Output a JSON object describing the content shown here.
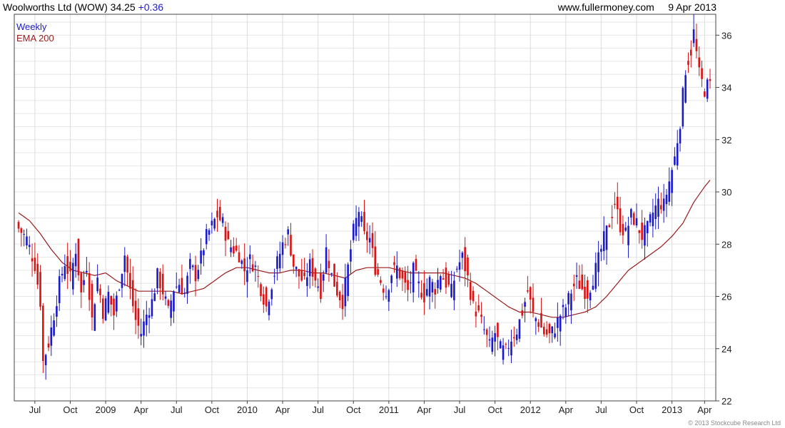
{
  "header": {
    "title": "Woolworths Ltd (WOW)",
    "price": "34.25",
    "change": "+0.36",
    "source": "www.fullermoney.com",
    "date": "9 Apr 2013"
  },
  "footer": {
    "copyright": "© 2013 Stockcube Research Ltd"
  },
  "chart_data": {
    "type": "line",
    "title": "Woolworths Ltd (WOW)",
    "legend": [
      {
        "name": "Weekly",
        "color": "#1a1acc"
      },
      {
        "name": "EMA 200",
        "color": "#9a1a1a"
      }
    ],
    "legend_placement": "top-left",
    "up_color": "#1a1acc",
    "down_color": "#dd1111",
    "ema_color": "#9a1a1a",
    "grid": true,
    "y_axis": {
      "position": "right",
      "min": 22,
      "max": 36.8,
      "ticks": [
        22,
        24,
        26,
        28,
        30,
        32,
        34,
        36
      ]
    },
    "x_axis": {
      "labels": [
        "Jul",
        "Oct",
        "2009",
        "Apr",
        "Jul",
        "Oct",
        "2010",
        "Apr",
        "Jul",
        "Oct",
        "2011",
        "Apr",
        "Jul",
        "Oct",
        "2012",
        "Apr",
        "Jul",
        "Oct",
        "2013",
        "Apr"
      ],
      "label_weeks": [
        6,
        19,
        32,
        45,
        58,
        71,
        84,
        97,
        110,
        123,
        136,
        149,
        162,
        175,
        188,
        201,
        214,
        227,
        240,
        252
      ]
    },
    "weeks": 255,
    "series": [
      {
        "name": "Weekly",
        "anchors": [
          [
            0,
            28.6
          ],
          [
            3,
            28.2
          ],
          [
            6,
            27.2
          ],
          [
            8,
            25.8
          ],
          [
            9,
            23.5
          ],
          [
            11,
            24.2
          ],
          [
            13,
            25.3
          ],
          [
            15,
            26.5
          ],
          [
            17,
            27.3
          ],
          [
            19,
            26.7
          ],
          [
            21,
            27.8
          ],
          [
            23,
            26.1
          ],
          [
            25,
            27.2
          ],
          [
            27,
            25.1
          ],
          [
            29,
            26.7
          ],
          [
            31,
            25.4
          ],
          [
            33,
            26.1
          ],
          [
            35,
            25.3
          ],
          [
            37,
            26.5
          ],
          [
            39,
            27.6
          ],
          [
            41,
            26.2
          ],
          [
            43,
            25.1
          ],
          [
            45,
            24.6
          ],
          [
            47,
            25.3
          ],
          [
            49,
            25.8
          ],
          [
            51,
            26.8
          ],
          [
            53,
            26.2
          ],
          [
            55,
            25.4
          ],
          [
            57,
            26.3
          ],
          [
            59,
            26.5
          ],
          [
            61,
            26.1
          ],
          [
            63,
            27.2
          ],
          [
            65,
            26.8
          ],
          [
            67,
            27.5
          ],
          [
            69,
            28.3
          ],
          [
            71,
            28.7
          ],
          [
            73,
            29.1
          ],
          [
            75,
            28.8
          ],
          [
            77,
            28.0
          ],
          [
            79,
            27.8
          ],
          [
            81,
            27.6
          ],
          [
            83,
            27.0
          ],
          [
            85,
            27.4
          ],
          [
            87,
            27.1
          ],
          [
            89,
            26.3
          ],
          [
            91,
            25.6
          ],
          [
            93,
            26.5
          ],
          [
            95,
            27.3
          ],
          [
            97,
            28.0
          ],
          [
            99,
            28.4
          ],
          [
            101,
            27.2
          ],
          [
            103,
            26.8
          ],
          [
            105,
            26.5
          ],
          [
            107,
            27.2
          ],
          [
            109,
            26.7
          ],
          [
            111,
            26.2
          ],
          [
            113,
            27.8
          ],
          [
            115,
            26.8
          ],
          [
            117,
            26.2
          ],
          [
            119,
            25.8
          ],
          [
            121,
            27.1
          ],
          [
            123,
            28.5
          ],
          [
            125,
            29.3
          ],
          [
            127,
            28.3
          ],
          [
            129,
            28.2
          ],
          [
            131,
            27.1
          ],
          [
            133,
            26.6
          ],
          [
            135,
            26.1
          ],
          [
            137,
            26.9
          ],
          [
            139,
            27.1
          ],
          [
            141,
            26.6
          ],
          [
            143,
            26.2
          ],
          [
            145,
            27.0
          ],
          [
            147,
            26.4
          ],
          [
            149,
            26.0
          ],
          [
            151,
            26.6
          ],
          [
            153,
            26.3
          ],
          [
            155,
            26.9
          ],
          [
            157,
            26.5
          ],
          [
            159,
            26.2
          ],
          [
            161,
            27.1
          ],
          [
            163,
            27.5
          ],
          [
            165,
            26.7
          ],
          [
            167,
            25.6
          ],
          [
            169,
            25.3
          ],
          [
            171,
            24.7
          ],
          [
            173,
            24.1
          ],
          [
            175,
            24.6
          ],
          [
            177,
            24.0
          ],
          [
            179,
            23.9
          ],
          [
            181,
            24.4
          ],
          [
            183,
            24.7
          ],
          [
            185,
            25.4
          ],
          [
            187,
            26.2
          ],
          [
            189,
            25.3
          ],
          [
            191,
            25.0
          ],
          [
            193,
            24.6
          ],
          [
            195,
            24.5
          ],
          [
            197,
            24.8
          ],
          [
            199,
            25.3
          ],
          [
            201,
            25.6
          ],
          [
            203,
            26.2
          ],
          [
            205,
            26.6
          ],
          [
            207,
            26.3
          ],
          [
            209,
            26.1
          ],
          [
            211,
            26.7
          ],
          [
            213,
            27.4
          ],
          [
            215,
            28.2
          ],
          [
            217,
            28.8
          ],
          [
            219,
            29.6
          ],
          [
            221,
            28.7
          ],
          [
            223,
            28.4
          ],
          [
            225,
            29.1
          ],
          [
            227,
            28.8
          ],
          [
            229,
            28.3
          ],
          [
            231,
            28.6
          ],
          [
            233,
            29.2
          ],
          [
            235,
            29.6
          ],
          [
            237,
            29.5
          ],
          [
            239,
            30.4
          ],
          [
            241,
            31.3
          ],
          [
            243,
            32.7
          ],
          [
            245,
            34.7
          ],
          [
            247,
            35.4
          ],
          [
            248,
            36.1
          ],
          [
            250,
            34.5
          ],
          [
            252,
            33.9
          ],
          [
            254,
            34.25
          ]
        ]
      },
      {
        "name": "EMA 200",
        "anchors": [
          [
            0,
            29.2
          ],
          [
            4,
            28.9
          ],
          [
            8,
            28.4
          ],
          [
            12,
            27.8
          ],
          [
            16,
            27.3
          ],
          [
            20,
            27.0
          ],
          [
            24,
            26.9
          ],
          [
            28,
            26.8
          ],
          [
            32,
            26.9
          ],
          [
            36,
            26.6
          ],
          [
            40,
            26.4
          ],
          [
            44,
            26.2
          ],
          [
            48,
            26.2
          ],
          [
            52,
            26.2
          ],
          [
            56,
            26.2
          ],
          [
            60,
            26.1
          ],
          [
            64,
            26.2
          ],
          [
            68,
            26.3
          ],
          [
            72,
            26.6
          ],
          [
            76,
            26.9
          ],
          [
            80,
            27.1
          ],
          [
            84,
            27.1
          ],
          [
            88,
            27.0
          ],
          [
            92,
            26.9
          ],
          [
            96,
            26.9
          ],
          [
            100,
            27.0
          ],
          [
            104,
            27.0
          ],
          [
            108,
            26.9
          ],
          [
            112,
            26.9
          ],
          [
            116,
            26.8
          ],
          [
            120,
            26.7
          ],
          [
            124,
            27.0
          ],
          [
            128,
            27.1
          ],
          [
            132,
            27.1
          ],
          [
            136,
            27.1
          ],
          [
            140,
            27.0
          ],
          [
            144,
            26.9
          ],
          [
            148,
            26.9
          ],
          [
            152,
            26.9
          ],
          [
            156,
            26.9
          ],
          [
            160,
            26.8
          ],
          [
            164,
            26.7
          ],
          [
            168,
            26.5
          ],
          [
            172,
            26.2
          ],
          [
            176,
            25.9
          ],
          [
            180,
            25.6
          ],
          [
            184,
            25.4
          ],
          [
            188,
            25.4
          ],
          [
            192,
            25.3
          ],
          [
            196,
            25.2
          ],
          [
            200,
            25.2
          ],
          [
            204,
            25.3
          ],
          [
            208,
            25.4
          ],
          [
            212,
            25.6
          ],
          [
            216,
            26.0
          ],
          [
            220,
            26.5
          ],
          [
            224,
            27.0
          ],
          [
            228,
            27.3
          ],
          [
            232,
            27.6
          ],
          [
            236,
            27.9
          ],
          [
            240,
            28.3
          ],
          [
            244,
            28.8
          ],
          [
            248,
            29.6
          ],
          [
            252,
            30.2
          ],
          [
            254,
            30.45
          ]
        ]
      }
    ]
  }
}
